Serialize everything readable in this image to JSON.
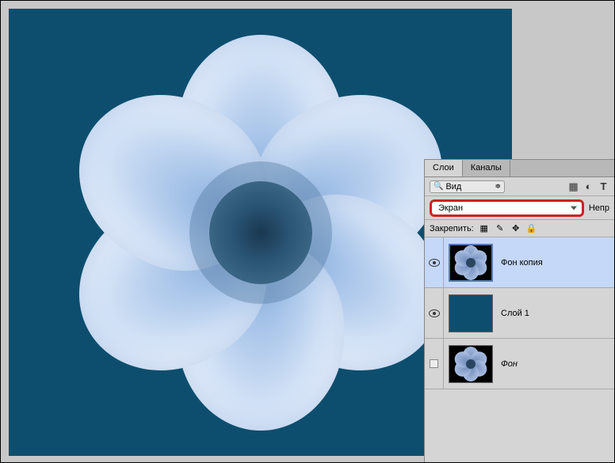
{
  "panel": {
    "tabs": {
      "layers": "Слои",
      "channels": "Каналы"
    },
    "filter_label": "Вид",
    "blend_mode": "Экран",
    "opacity_label": "Непр",
    "lock_label": "Закрепить:"
  },
  "layers": [
    {
      "name": "Фон копия",
      "visible": true,
      "selected": true,
      "thumb": "flower"
    },
    {
      "name": "Слой 1",
      "visible": true,
      "selected": false,
      "thumb": "solid"
    },
    {
      "name": "Фон",
      "visible": false,
      "selected": false,
      "thumb": "flower",
      "italic": true
    }
  ],
  "colors": {
    "canvas_bg": "#0d4e6e",
    "highlight": "#d02020"
  }
}
